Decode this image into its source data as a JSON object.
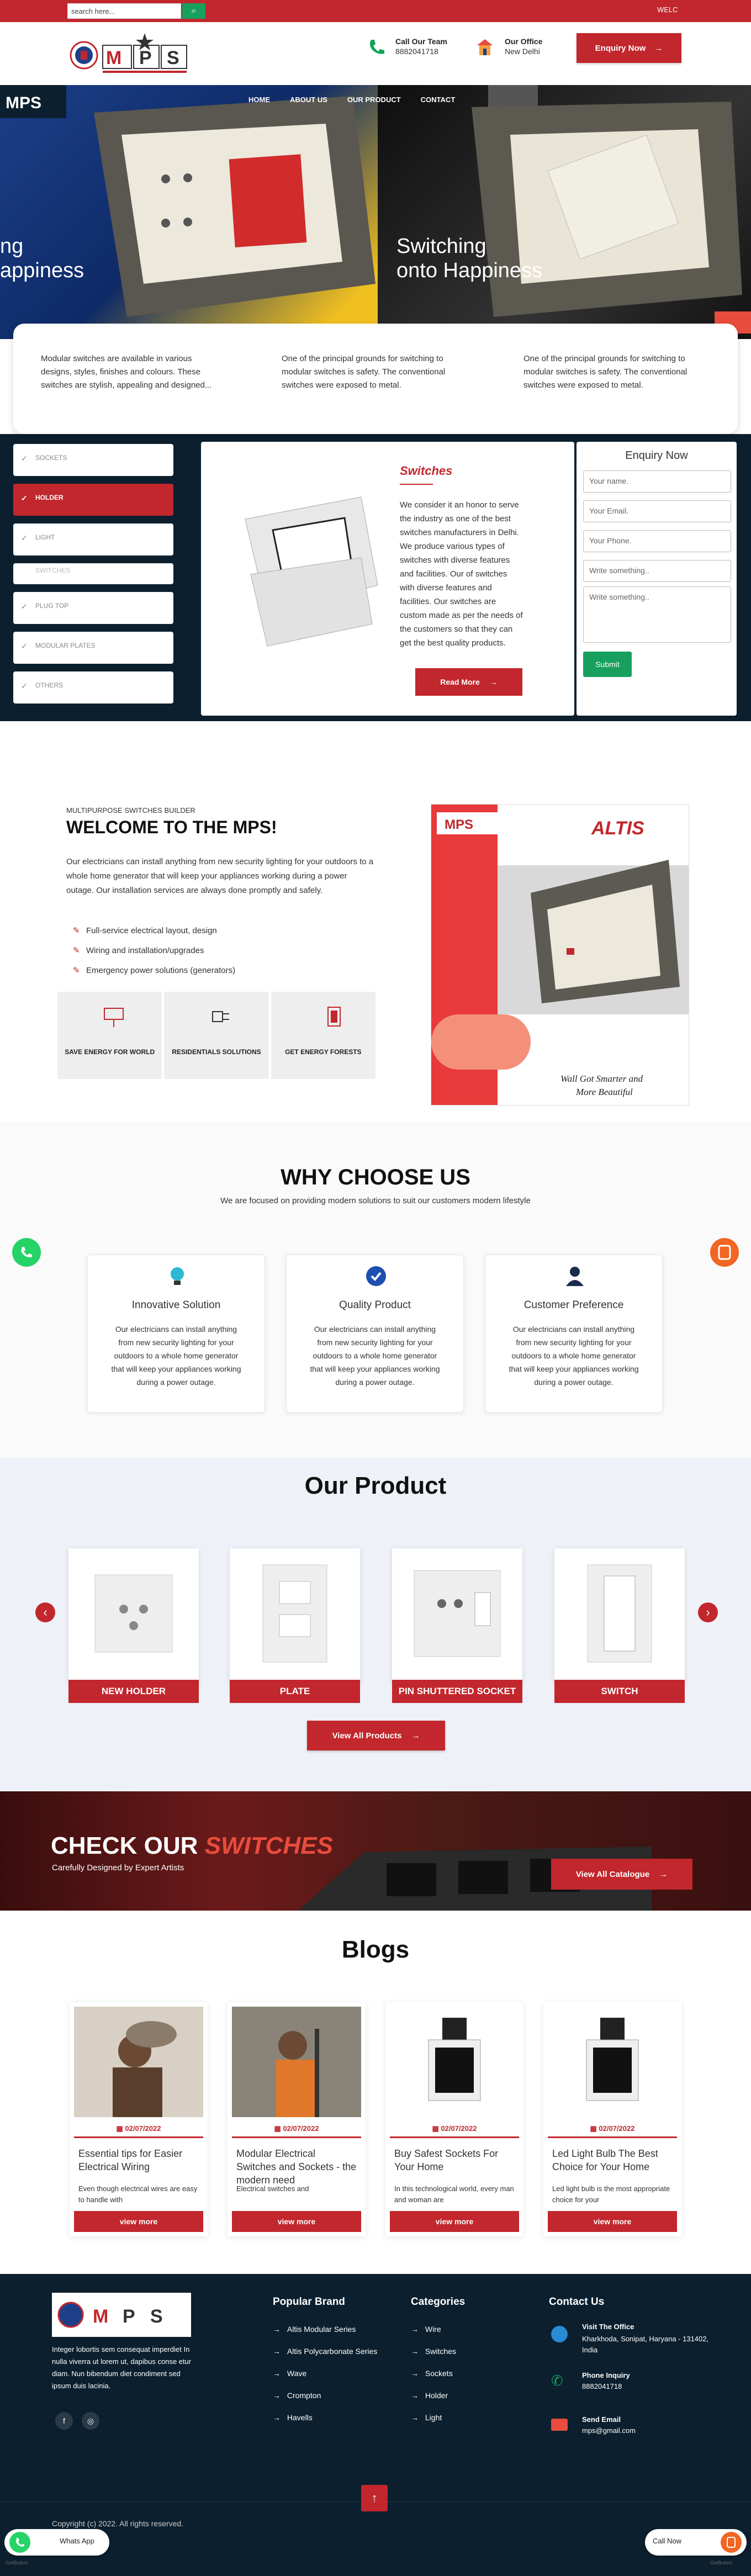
{
  "topbar": {
    "search_placeholder": "search here...",
    "welcome": "WELC"
  },
  "header": {
    "team_label": "Call Our Team",
    "team_value": "8882041718",
    "office_label": "Our Office",
    "office_value": "New Delhi",
    "enquiry": "Enquiry Now"
  },
  "nav": {
    "items": [
      "HOME",
      "ABOUT US",
      "OUR PRODUCT",
      "CONTACT"
    ]
  },
  "hero": {
    "left_line1": "ng",
    "left_line2": "appiness",
    "right_line1": "Switching",
    "right_line2": "onto Happiness"
  },
  "features": [
    "Modular switches are available in various designs, styles, finishes and colours. These switches are stylish, appealing and designed...",
    "One of the principal grounds for switching to modular switches is safety. The conventional switches were exposed to metal.",
    "One of the principal grounds for switching to modular switches is safety. The conventional switches were exposed to metal."
  ],
  "categories": [
    "SOCKETS",
    "HOLDER",
    "LIGHT",
    "SWITCHES",
    "PLUG TOP",
    "MODULAR PLATES",
    "OTHERS"
  ],
  "product": {
    "title": "Switches",
    "desc": "We consider it an honor to serve the industry as one of the best switches manufacturers in Delhi. We produce various types of switches with diverse features and facilities. Our of switches with diverse features and facilities. Our switches are custom made as per the needs of the customers so that they can get the best quality products.",
    "read_more": "Read More"
  },
  "enquiry_form": {
    "title": "Enquiry Now",
    "name": "Your name.",
    "email": "Your Email.",
    "phone": "Your Phone.",
    "subject": "Write something..",
    "message": "Write something..",
    "submit": "Submit"
  },
  "welcome": {
    "small": "MULTIPURPOSE SWITCHES BUILDER",
    "title": "WELCOME TO THE MPS!",
    "text": "Our electricians can install anything from new security lighting for your outdoors to a whole home generator that will keep your appliances working during a power outage. Our installation services are always done promptly and safely.",
    "bullets": [
      "Full-service electrical layout, design",
      "Wiring and installation/upgrades",
      "Emergency power solutions (generators)"
    ],
    "boxes": [
      "SAVE ENERGY FOR WORLD",
      "RESIDENTIALS SOLUTIONS",
      "GET ENERGY FORESTS"
    ]
  },
  "promo": {
    "brand": "ALTIS",
    "tagline1": "Wall Got Smarter and",
    "tagline2": "More Beautiful"
  },
  "why": {
    "title": "WHY CHOOSE US",
    "subtitle": "We are focused on providing modern solutions to suit our customers modern lifestyle",
    "cards": [
      {
        "title": "Innovative Solution",
        "text": "Our electricians can install anything from new security lighting for your outdoors to a whole home generator that will keep your appliances working during a power outage."
      },
      {
        "title": "Quality Product",
        "text": "Our electricians can install anything from new security lighting for your outdoors to a whole home generator that will keep your appliances working during a power outage."
      },
      {
        "title": "Customer Preference",
        "text": "Our electricians can install anything from new security lighting for your outdoors to a whole home generator that will keep your appliances working during a power outage."
      }
    ]
  },
  "products": {
    "title": "Our Product",
    "items": [
      "NEW HOLDER",
      "PLATE",
      "PIN SHUTTERED SOCKET",
      "SWITCH"
    ],
    "view_all": "View All Products"
  },
  "check": {
    "title_a": "CHECK OUR ",
    "title_b": "SWITCHES",
    "sub": "Carefully Designed by Expert Artists",
    "btn": "View All Catalogue"
  },
  "blogs": {
    "title": "Blogs",
    "items": [
      {
        "date": "02/07/2022",
        "title": "Essential tips for Easier Electrical Wiring",
        "desc": "Even though electrical wires are easy to handle with",
        "btn": "view more"
      },
      {
        "date": "02/07/2022",
        "title": "Modular Electrical Switches and Sockets - the modern need",
        "desc": "Electrical switches and",
        "btn": "view more"
      },
      {
        "date": "02/07/2022",
        "title": "Buy Safest Sockets For Your Home",
        "desc": "In this technological world, every man and woman are",
        "btn": "view more"
      },
      {
        "date": "02/07/2022",
        "title": "Led Light Bulb The Best Choice for Your Home",
        "desc": "Led light bulb is the most appropriate choice for your",
        "btn": "view more"
      }
    ]
  },
  "footer": {
    "about": "Integer lobortis sem consequat imperdiet In nulla viverra ut lorem ut, dapibus conse etur diam. Nun bibendum diet condiment sed ipsum duis lacinia.",
    "brand_title": "Popular Brand",
    "brands": [
      "Altis Modular Series",
      "Altis Polycarbonate Series",
      "Wave",
      "Crompton",
      "Havells"
    ],
    "cat_title": "Categories",
    "cats": [
      "Wire",
      "Switches",
      "Sockets",
      "Holder",
      "Light"
    ],
    "contact_title": "Contact Us",
    "visit_label": "Visit The Office",
    "visit_value": "Kharkhoda, Sonipat, Haryana - 131402, India",
    "phone_label": "Phone Inquiry",
    "phone_value": "8882041718",
    "email_label": "Send Email",
    "email_value": "mps@gmail.com",
    "copyright": "Copyright (c) 2022. All rights reserved."
  },
  "floating": {
    "whatsapp": "Whats App",
    "call": "Call Now",
    "getbutton": "GetButton"
  },
  "colors": {
    "brand_red": "#c1272d",
    "dark": "#0b1f2e",
    "green": "#17a05d"
  }
}
